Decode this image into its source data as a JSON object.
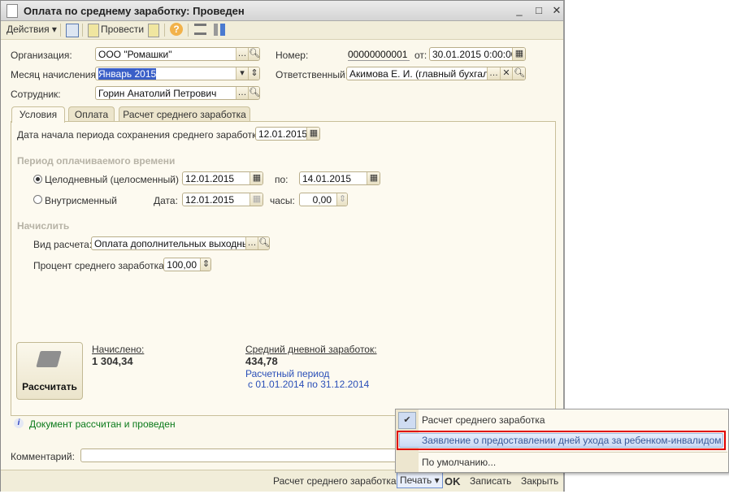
{
  "window": {
    "title": "Оплата по среднему заработку: Проведен",
    "minimize": "_",
    "maximize": "□",
    "close": "✕"
  },
  "toolbar": {
    "actions": "Действия ▾",
    "post": "Провести"
  },
  "header": {
    "org_label": "Организация:",
    "org_value": "ООО \"Ромашки\"",
    "month_label": "Месяц начисления:",
    "month_value": "Январь 2015",
    "employee_label": "Сотрудник:",
    "employee_value": "Горин Анатолий Петрович",
    "number_label": "Номер:",
    "number_value": "00000000001",
    "date_label": "от:",
    "date_value": "30.01.2015  0:00:00",
    "responsible_label": "Ответственный:",
    "responsible_value": "Акимова Е. И. (главный бухгалтер)"
  },
  "tabs": [
    {
      "label": "Условия",
      "active": true
    },
    {
      "label": "Оплата"
    },
    {
      "label": "Расчет среднего заработка"
    }
  ],
  "conditions": {
    "start_label": "Дата начала периода сохранения среднего заработка:",
    "start_value": "12.01.2015",
    "period_heading": "Период оплачиваемого времени",
    "fullday_label": "Целодневный (целосменный) с:",
    "fullday_from": "12.01.2015",
    "to_label": "по:",
    "fullday_to": "14.01.2015",
    "intraday_label": "Внутрисменный",
    "date_label": "Дата:",
    "intraday_date": "12.01.2015",
    "hours_label": "часы:",
    "hours_value": "0,00",
    "accrue_heading": "Начислить",
    "calc_type_label": "Вид расчета:",
    "calc_type_value": "Оплата дополнительных выходных дней",
    "percent_label": "Процент среднего заработка:",
    "percent_value": "100,00"
  },
  "results": {
    "calc_button": "Рассчитать",
    "accrued_label": "Начислено:",
    "accrued_value": "1 304,34",
    "avg_label": "Средний дневной заработок:",
    "avg_value": "434,78",
    "period_line1": "Расчетный период",
    "period_line2": "с 01.01.2014 по 31.12.2014"
  },
  "status": "Документ рассчитан и проведен",
  "comment": {
    "label": "Комментарий:",
    "value": ""
  },
  "bottom": {
    "avg_report": "Расчет среднего заработка",
    "print": "Печать ▾",
    "ok": "OK",
    "save": "Записать",
    "close": "Закрыть"
  },
  "print_menu": [
    {
      "label": "Расчет среднего заработка",
      "checked": true
    },
    {
      "label": "Заявление о предоставлении дней ухода за ребенком-инвалидом",
      "highlighted": true
    },
    {
      "label": "По умолчанию..."
    }
  ],
  "colors": {
    "highlight": "#e00000",
    "link": "#2a4fb8",
    "status": "#0a7a1a"
  }
}
